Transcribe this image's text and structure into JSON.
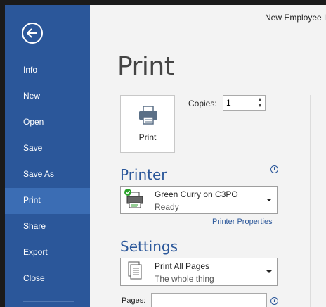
{
  "window": {
    "doc_title": "New Employee L"
  },
  "sidebar": {
    "back_icon": "back-arrow-icon",
    "items": [
      {
        "label": "Info"
      },
      {
        "label": "New"
      },
      {
        "label": "Open"
      },
      {
        "label": "Save"
      },
      {
        "label": "Save As"
      },
      {
        "label": "Print",
        "active": true
      },
      {
        "label": "Share"
      },
      {
        "label": "Export"
      },
      {
        "label": "Close"
      }
    ]
  },
  "main": {
    "title": "Print",
    "print_button": {
      "label": "Print",
      "icon": "printer-icon"
    },
    "copies": {
      "label": "Copies:",
      "value": "1"
    },
    "printer": {
      "heading": "Printer",
      "name": "Green Curry on C3PO",
      "status": "Ready",
      "properties_link": "Printer Properties"
    },
    "settings": {
      "heading": "Settings",
      "range_option": "Print All Pages",
      "range_desc": "The whole thing",
      "pages_label": "Pages:",
      "pages_value": ""
    }
  },
  "colors": {
    "sidebar": "#2b579a",
    "sidebar_active": "#3b6db4",
    "accent": "#2b579a",
    "background": "#f3f3f3"
  }
}
